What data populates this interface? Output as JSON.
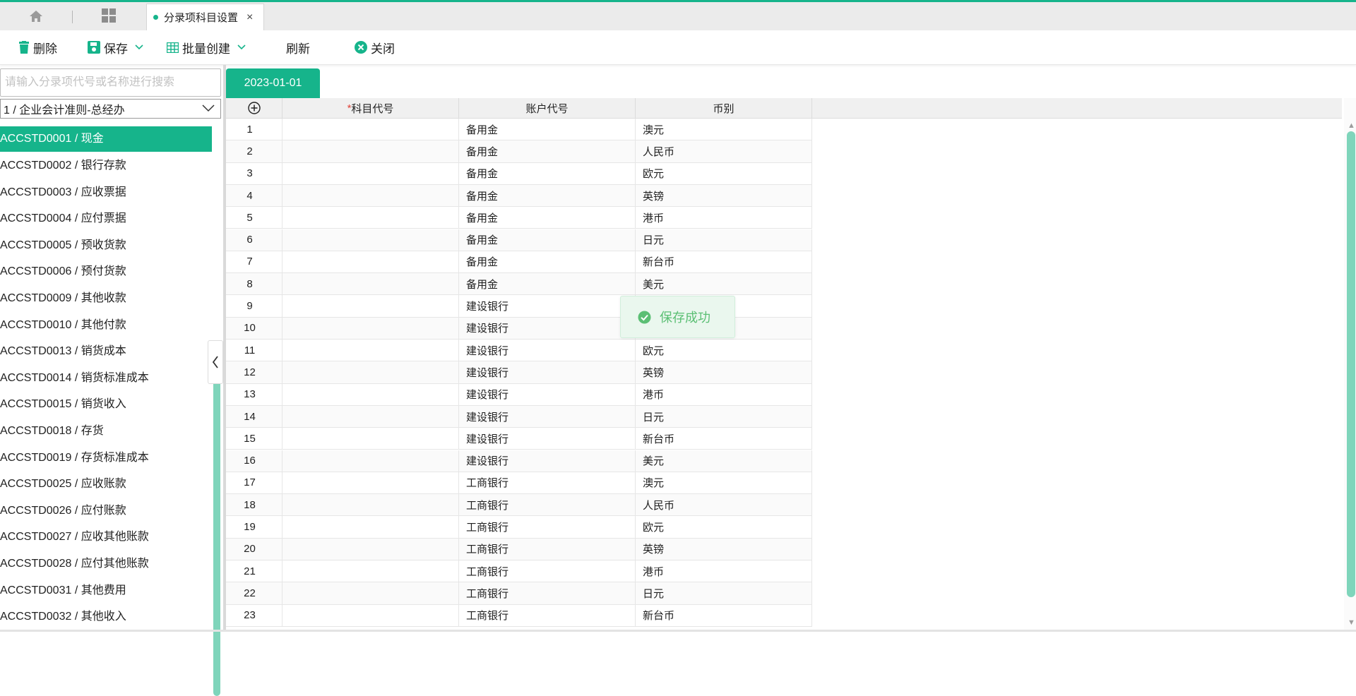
{
  "tabbar": {
    "home_icon": "home-icon",
    "grid_icon": "grid-icon",
    "active_tab": {
      "title": "分录项科目设置",
      "close": "×"
    }
  },
  "toolbar": {
    "delete_label": "删除",
    "save_label": "保存",
    "batch_create_label": "批量创建",
    "refresh_label": "刷新",
    "close_label": "关闭"
  },
  "sidebar": {
    "search_placeholder": "请输入分录项代号或名称进行搜索",
    "selected_book": "1 / 企业会计准则-总经办",
    "accounts": [
      "ACCSTD0001 / 现金",
      "ACCSTD0002 / 银行存款",
      "ACCSTD0003 / 应收票据",
      "ACCSTD0004 / 应付票据",
      "ACCSTD0005 / 预收货款",
      "ACCSTD0006 / 预付货款",
      "ACCSTD0009 / 其他收款",
      "ACCSTD0010 / 其他付款",
      "ACCSTD0013 / 销货成本",
      "ACCSTD0014 / 销货标准成本",
      "ACCSTD0015 / 销货收入",
      "ACCSTD0018 / 存货",
      "ACCSTD0019 / 存货标准成本",
      "ACCSTD0025 / 应收账款",
      "ACCSTD0026 / 应付账款",
      "ACCSTD0027 / 应收其他账款",
      "ACCSTD0028 / 应付其他账款",
      "ACCSTD0031 / 其他费用",
      "ACCSTD0032 / 其他收入"
    ],
    "selected_index": 0
  },
  "main": {
    "date_tab": "2023-01-01",
    "columns": {
      "add_icon": "plus-circle-icon",
      "required_mark": "*",
      "subject_code": "科目代号",
      "account_code": "账户代号",
      "currency": "币别"
    },
    "rows": [
      {
        "no": "1",
        "subject": "",
        "account": "备用金",
        "currency": "澳元"
      },
      {
        "no": "2",
        "subject": "",
        "account": "备用金",
        "currency": "人民币"
      },
      {
        "no": "3",
        "subject": "",
        "account": "备用金",
        "currency": "欧元"
      },
      {
        "no": "4",
        "subject": "",
        "account": "备用金",
        "currency": "英镑"
      },
      {
        "no": "5",
        "subject": "",
        "account": "备用金",
        "currency": "港币"
      },
      {
        "no": "6",
        "subject": "",
        "account": "备用金",
        "currency": "日元"
      },
      {
        "no": "7",
        "subject": "",
        "account": "备用金",
        "currency": "新台币"
      },
      {
        "no": "8",
        "subject": "",
        "account": "备用金",
        "currency": "美元"
      },
      {
        "no": "9",
        "subject": "",
        "account": "建设银行",
        "currency": ""
      },
      {
        "no": "10",
        "subject": "",
        "account": "建设银行",
        "currency": ""
      },
      {
        "no": "11",
        "subject": "",
        "account": "建设银行",
        "currency": "欧元"
      },
      {
        "no": "12",
        "subject": "",
        "account": "建设银行",
        "currency": "英镑"
      },
      {
        "no": "13",
        "subject": "",
        "account": "建设银行",
        "currency": "港币"
      },
      {
        "no": "14",
        "subject": "",
        "account": "建设银行",
        "currency": "日元"
      },
      {
        "no": "15",
        "subject": "",
        "account": "建设银行",
        "currency": "新台币"
      },
      {
        "no": "16",
        "subject": "",
        "account": "建设银行",
        "currency": "美元"
      },
      {
        "no": "17",
        "subject": "",
        "account": "工商银行",
        "currency": "澳元"
      },
      {
        "no": "18",
        "subject": "",
        "account": "工商银行",
        "currency": "人民币"
      },
      {
        "no": "19",
        "subject": "",
        "account": "工商银行",
        "currency": "欧元"
      },
      {
        "no": "20",
        "subject": "",
        "account": "工商银行",
        "currency": "英镑"
      },
      {
        "no": "21",
        "subject": "",
        "account": "工商银行",
        "currency": "港币"
      },
      {
        "no": "22",
        "subject": "",
        "account": "工商银行",
        "currency": "日元"
      },
      {
        "no": "23",
        "subject": "",
        "account": "工商银行",
        "currency": "新台币"
      }
    ]
  },
  "toast": {
    "icon": "check-circle-icon",
    "message": "保存成功"
  },
  "colors": {
    "accent": "#16b48b",
    "toast_text": "#5bbf74",
    "required": "#e0443b"
  }
}
